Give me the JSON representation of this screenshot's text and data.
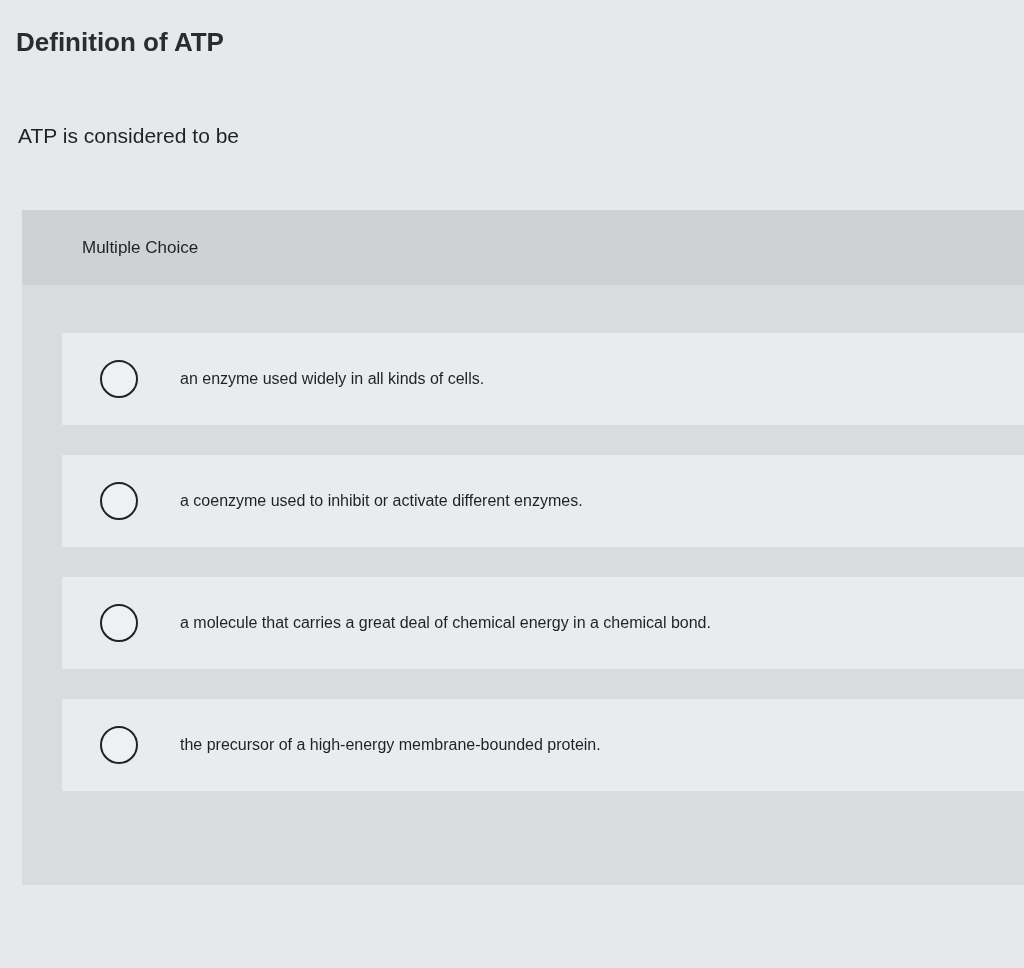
{
  "title": "Definition of ATP",
  "question": "ATP is considered to be",
  "panel": {
    "header": "Multiple Choice",
    "options": [
      {
        "text": "an enzyme used widely in all kinds of cells.",
        "selected": false
      },
      {
        "text": "a coenzyme used to inhibit or activate different enzymes.",
        "selected": false
      },
      {
        "text": "a molecule that carries a great deal of chemical energy in a chemical bond.",
        "selected": false
      },
      {
        "text": "the precursor of a high-energy membrane-bounded protein.",
        "selected": false
      }
    ]
  }
}
